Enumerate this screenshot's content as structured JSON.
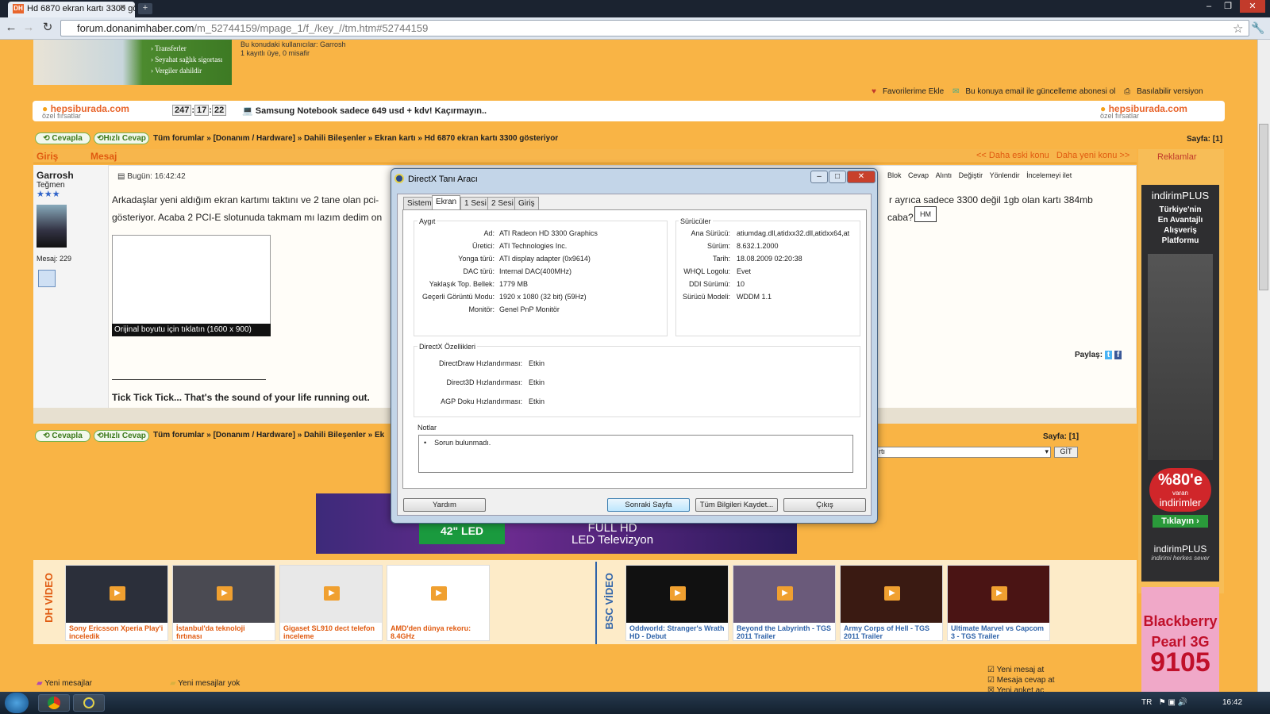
{
  "browser": {
    "tab_title": "Hd 6870 ekran kartı 3300 gö",
    "favicon": "DH",
    "url_host": "forum.donanimhaber.com",
    "url_path": "/m_52744159/mpage_1/f_/key_//tm.htm#52744159"
  },
  "top": {
    "ad_lines": [
      "› Transferler",
      "› Seyahat sağlık sigortası",
      "› Vergiler dahildir"
    ],
    "viewers_line1": "Bu konudaki kullanıcılar: Garrosh",
    "viewers_line2": "1 kayıtlı üye, 0 misafir",
    "fav_add": "Favorilerime Ekle",
    "email_sub": "Bu konuya email ile güncelleme abonesi ol",
    "printable": "Basılabilir versiyon"
  },
  "promo": {
    "brand": "hepsiburada.com",
    "brand_sub": "özel fırsatlar",
    "timer": [
      "247",
      "17",
      "22"
    ],
    "text": "Samsung Notebook sadece 649 usd + kdv! Kaçırmayın.."
  },
  "nav": {
    "reply": "Cevapla",
    "quick_reply": "Hızlı Cevap",
    "breadcrumb": "Tüm forumlar » [Donanım / Hardware] » Dahili Bileşenler » Ekran kartı » Hd 6870 ekran kartı 3300 gösteriyor",
    "breadcrumb_short": "Tüm forumlar » [Donanım / Hardware] » Dahili Bileşenler » Ek",
    "page_label": "Sayfa:",
    "page_value": "[1]"
  },
  "post": {
    "header_login": "Giriş",
    "header_message": "Mesaj",
    "older": "<< Daha eski konu",
    "newer": "Daha yeni konu >>",
    "username": "Garrosh",
    "rank": "Teğmen",
    "stars": "★★★",
    "post_count": "Mesaj: 229",
    "time": "Bugün: 16:42:42",
    "line1": "Arkadaşlar yeni aldığım ekran kartımı taktını ve 2 tane olan pci-",
    "line1_end": "r ayrıca sadece 3300 değil 1gb olan kartı 384mb",
    "line2": "gösteriyor. Acaba 2 PCI-E slotunuda takmam mı lazım dedim on",
    "line2_end": "caba?",
    "thumb_caption": "Orijinal boyutu için tıklatın (1600 x 900)",
    "signature": "Tick Tick Tick... That's the sound of your life running out.",
    "share": "Paylaş:",
    "tools": [
      "Blok",
      "Cevap",
      "Alıntı",
      "Değiştir",
      "Yönlendir",
      "İncelemeyi ilet"
    ],
    "hm": "HM"
  },
  "forum_select": {
    "value": "rtı",
    "go": "GİT"
  },
  "ads": {
    "title": "Reklamlar",
    "indirim_brand": "indirimPLUS",
    "indirim_lines": [
      "Türkiye'nin",
      "En Avantajlı",
      "Alışveriş",
      "Platformu"
    ],
    "indirim_discount": "%80'e",
    "indirim_discount_sub": "varan",
    "indirim_word": "indirimler",
    "indirim_cta": "Tıklayın",
    "indirim_slogan": "indirimi herkes sever",
    "bb_line1": "Blackberry",
    "bb_line2": "Pearl 3G",
    "bb_line3": "9105",
    "tv_line1": "FULL HD",
    "tv_line2": "LED Televizyon",
    "tv_led": "42\" LED"
  },
  "videos": {
    "dh_label": "DH VİDEO",
    "bsc_label": "BSC VİDEO",
    "dh": [
      "Sony Ericsson Xperia Play'i inceledik",
      "İstanbul'da teknoloji fırtınası",
      "Gigaset SL910 dect telefon inceleme",
      "AMD'den dünya rekoru: 8.4GHz"
    ],
    "bsc": [
      "Oddworld: Stranger's Wrath HD - Debut",
      "Beyond the Labyrinth - TGS 2011 Trailer",
      "Army Corps of Hell - TGS 2011 Trailer",
      "Ultimate Marvel vs Capcom 3 - TGS Trailer"
    ]
  },
  "footer": {
    "new_msgs": "Yeni mesajlar",
    "no_new": "Yeni mesajlar yok",
    "checks": [
      "Yeni mesaj at",
      "Mesaja cevap at",
      "Yeni anket aç"
    ]
  },
  "dialog": {
    "title": "DirectX Tanı Aracı",
    "tabs": [
      "Sistem",
      "Ekran",
      "1 Sesi",
      "2 Sesi",
      "Giriş"
    ],
    "device_title": "Aygıt",
    "drivers_title": "Sürücüler",
    "device": [
      {
        "label": "Ad:",
        "value": "ATI Radeon HD 3300 Graphics"
      },
      {
        "label": "Üretici:",
        "value": "ATI Technologies Inc."
      },
      {
        "label": "Yonga türü:",
        "value": "ATI display adapter (0x9614)"
      },
      {
        "label": "DAC türü:",
        "value": "Internal DAC(400MHz)"
      },
      {
        "label": "Yaklaşık Top. Bellek:",
        "value": "1779 MB"
      },
      {
        "label": "Geçerli Görüntü Modu:",
        "value": "1920 x 1080 (32 bit) (59Hz)"
      },
      {
        "label": "Monitör:",
        "value": "Genel PnP Monitör"
      }
    ],
    "drivers": [
      {
        "label": "Ana Sürücü:",
        "value": "atiumdag.dll,atidxx32.dll,atidxx64,at"
      },
      {
        "label": "Sürüm:",
        "value": "8.632.1.2000"
      },
      {
        "label": "Tarih:",
        "value": "18.08.2009 02:20:38"
      },
      {
        "label": "WHQL Logolu:",
        "value": "Evet"
      },
      {
        "label": "DDI Sürümü:",
        "value": "10"
      },
      {
        "label": "Sürücü Modeli:",
        "value": "WDDM 1.1"
      }
    ],
    "features_title": "DirectX Özellikleri",
    "features": [
      {
        "label": "DirectDraw Hızlandırması:",
        "value": "Etkin"
      },
      {
        "label": "Direct3D Hızlandırması:",
        "value": "Etkin"
      },
      {
        "label": "AGP Doku Hızlandırması:",
        "value": "Etkin"
      }
    ],
    "notes_title": "Notlar",
    "notes_item": "Sorun bulunmadı.",
    "btn_help": "Yardım",
    "btn_next": "Sonraki Sayfa",
    "btn_save": "Tüm Bilgileri Kaydet...",
    "btn_exit": "Çıkış"
  },
  "taskbar": {
    "lang": "TR",
    "clock": "16:42"
  }
}
